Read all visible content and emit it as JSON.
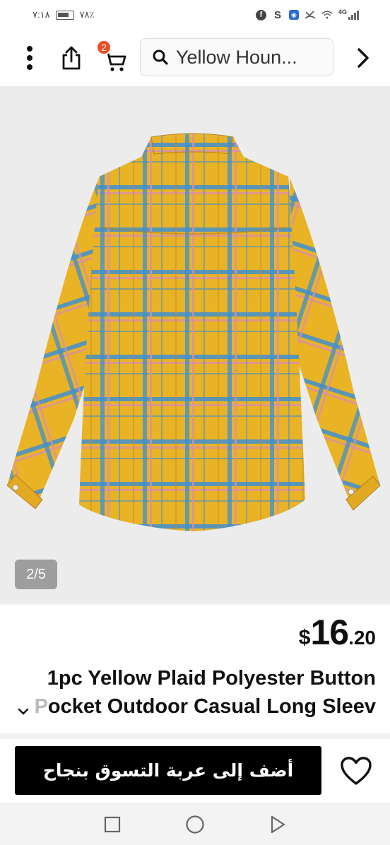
{
  "status_bar": {
    "time": "٧:١٨",
    "battery_percent": "٧٨٪",
    "network_label": "4G",
    "icons": [
      "facebook-icon",
      "s-app-icon",
      "shield-app-icon",
      "missed-call-icon",
      "wifi-icon",
      "signal-icon"
    ]
  },
  "toolbar": {
    "cart_badge_count": "2",
    "search_text": "Yellow Houn...",
    "icons": [
      "more-vertical-icon",
      "share-icon",
      "cart-icon",
      "search-icon",
      "chevron-right-icon"
    ]
  },
  "gallery": {
    "page_indicator": "2/5",
    "current_image": 2,
    "total_images": 5
  },
  "product": {
    "price_currency": "$",
    "price_integer": "16",
    "price_decimal": ".20",
    "title_line1": "1pc Yellow Plaid Polyester Button",
    "title_line2_main": "ocket Outdoor Casual Long Sleev",
    "title_line2_faded": "P"
  },
  "actions": {
    "add_to_cart_label": "أضف إلى عربة التسوق بنجاح",
    "wishlist_icon": "heart-icon"
  },
  "nav_bar": {
    "icons": [
      "recent-apps-icon",
      "home-icon",
      "back-icon"
    ]
  },
  "colors": {
    "shirt_yellow": "#e9b326",
    "plaid_blue": "#3f8fd0",
    "plaid_pink": "#d98fa6",
    "badge_red": "#f04a23",
    "cta_black": "#000000"
  }
}
